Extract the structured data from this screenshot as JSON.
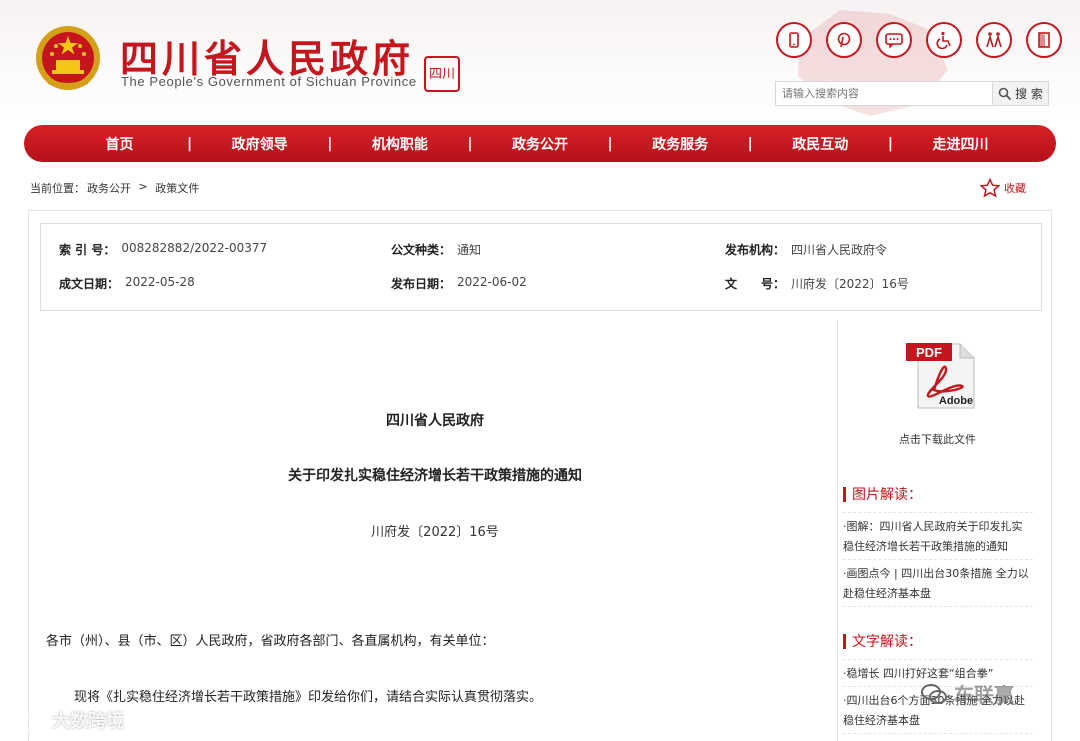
{
  "header": {
    "site_title": "四川省人民政府",
    "site_subtitle": "The People's Government of Sichuan Province",
    "seal_text": "四川",
    "brand_color": "#c4161c",
    "icons": [
      "mobile-icon",
      "pinterest-icon",
      "message-icon",
      "wheelchair-icon",
      "accessibility-icon",
      "exit-icon"
    ]
  },
  "search": {
    "placeholder": "请输入搜索内容",
    "button_label": "搜 索"
  },
  "nav": {
    "items": [
      "首页",
      "政府领导",
      "机构职能",
      "政务公开",
      "政务服务",
      "政民互动",
      "走进四川"
    ],
    "separator": "|"
  },
  "breadcrumb": {
    "prefix": "当前位置：",
    "items": [
      "政务公开",
      "政策文件"
    ],
    "separator": ">"
  },
  "favorite": {
    "label": "收藏"
  },
  "meta": {
    "index_label": "索 引 号：",
    "index_value": "008282882/2022-00377",
    "type_label": "公文种类：",
    "type_value": "通知",
    "issuer_label": "发布机构：",
    "issuer_value": "四川省人民政府令",
    "created_label": "成文日期：",
    "created_value": "2022-05-28",
    "published_label": "发布日期：",
    "published_value": "2022-06-02",
    "docno_label": "文　　号：",
    "docno_value": "川府发〔2022〕16号"
  },
  "article": {
    "issuer": "四川省人民政府",
    "title": "关于印发扎实稳住经济增长若干政策措施的通知",
    "doc_number": "川府发〔2022〕16号",
    "para1": "各市（州）、县（市、区）人民政府，省政府各部门、各直属机构，有关单位：",
    "para2": "现将《扎实稳住经济增长若干政策措施》印发给你们，请结合实际认真贯彻落实。"
  },
  "sidebar": {
    "pdf_badge": "PDF",
    "pdf_brand": "Adobe",
    "download_label": "点击下载此文件",
    "picture_heading": "图片解读：",
    "picture_items": [
      "·图解：四川省人民政府关于印发扎实稳住经济增长若干政策措施的通知",
      "·画图点今 | 四川出台30条措施 全力以赴稳住经济基本盘"
    ],
    "text_heading": "文字解读：",
    "text_items": [
      "·稳增长 四川打好这套“组合拳”",
      "·四川出台6个方面30条措施 全力以赴稳住经济基本盘"
    ]
  },
  "watermarks": {
    "left": "大数跨境",
    "right": "车联赢"
  }
}
